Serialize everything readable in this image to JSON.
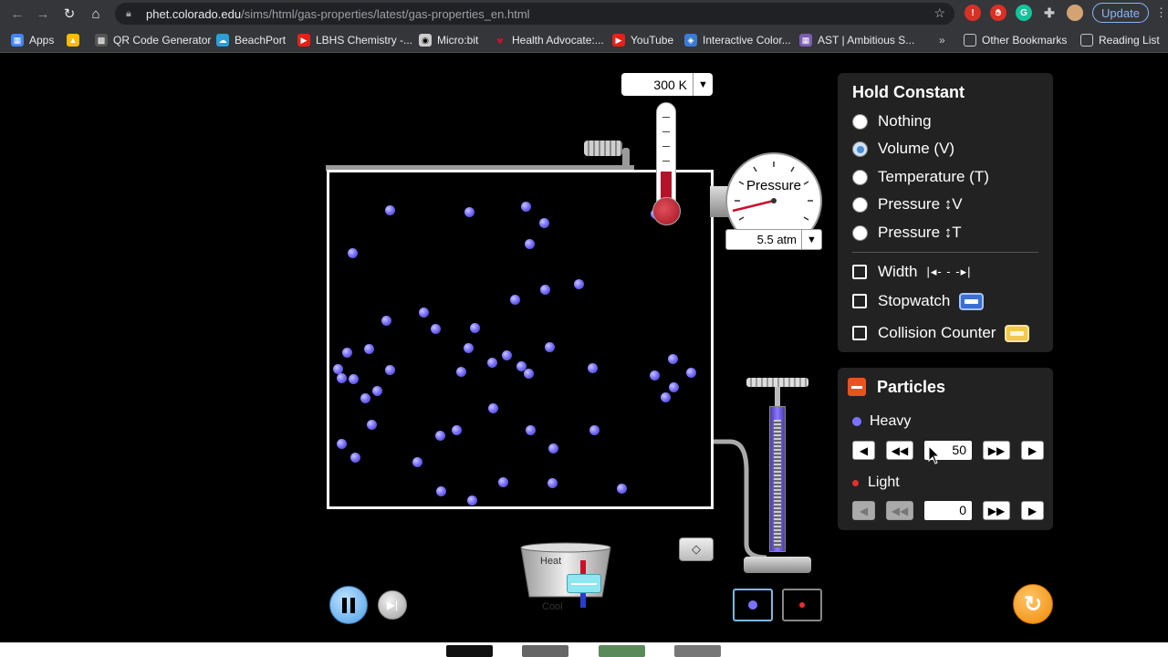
{
  "browser": {
    "url_host": "phet.colorado.edu",
    "url_path": "/sims/html/gas-properties/latest/gas-properties_en.html",
    "update_label": "Update",
    "bookmarks": [
      {
        "label": "Apps",
        "color": "#4285f4"
      },
      {
        "label": "QR Code Generator",
        "color": "#555555"
      },
      {
        "label": "BeachPort",
        "color": "#28a0d8"
      },
      {
        "label": "LBHS Chemistry -...",
        "color": "#e62117"
      },
      {
        "label": "Micro:bit",
        "color": "#cccccc"
      },
      {
        "label": "Health Advocate:...",
        "color": "#c8102e"
      },
      {
        "label": "YouTube",
        "color": "#e62117"
      },
      {
        "label": "Interactive Color...",
        "color": "#3a7bd5"
      },
      {
        "label": "AST | Ambitious S...",
        "color": "#7a5fb0"
      }
    ],
    "other_bookmarks": "Other Bookmarks",
    "reading_list": "Reading List"
  },
  "thermometer": {
    "readout": "300 K"
  },
  "gauge": {
    "label": "Pressure",
    "readout": "5.5 atm"
  },
  "hold_constant": {
    "title": "Hold Constant",
    "options": [
      {
        "label": "Nothing",
        "selected": false
      },
      {
        "label": "Volume (V)",
        "selected": true
      },
      {
        "label": "Temperature (T)",
        "selected": false
      },
      {
        "label": "Pressure ↕V",
        "selected": false
      },
      {
        "label": "Pressure ↕T",
        "selected": false
      }
    ],
    "checks": [
      {
        "label": "Width",
        "checked": false
      },
      {
        "label": "Stopwatch",
        "checked": false
      },
      {
        "label": "Collision Counter",
        "checked": false
      }
    ]
  },
  "particles": {
    "title": "Particles",
    "heavy_label": "Heavy",
    "heavy_count": "50",
    "light_label": "Light",
    "light_count": "0"
  },
  "heater": {
    "heat_label": "Heat",
    "cool_label": "Cool"
  }
}
